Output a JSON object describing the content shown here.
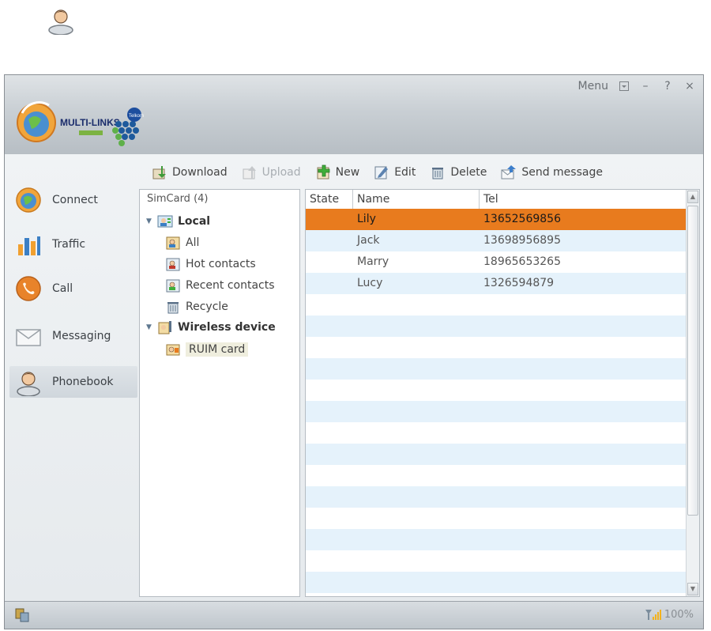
{
  "window": {
    "menu_label": "Menu",
    "controls": {
      "minimize": "–",
      "help": "?",
      "close": "×"
    }
  },
  "logo": {
    "brand": "MULTI-LINKS",
    "partner": "Telkom"
  },
  "sidebar": {
    "items": [
      {
        "label": "Connect",
        "icon": "globe-icon"
      },
      {
        "label": "Traffic",
        "icon": "bar-chart-icon"
      },
      {
        "label": "Call",
        "icon": "phone-icon"
      },
      {
        "label": "Messaging",
        "icon": "envelope-icon"
      },
      {
        "label": "Phonebook",
        "icon": "person-icon",
        "active": true
      }
    ]
  },
  "toolbar": {
    "download": "Download",
    "upload": "Upload",
    "new": "New",
    "edit": "Edit",
    "delete": "Delete",
    "send_message": "Send message"
  },
  "tree": {
    "header": "SimCard (4)",
    "local": "Local",
    "local_items": [
      "All",
      "Hot contacts",
      "Recent contacts",
      "Recycle"
    ],
    "wireless": "Wireless device",
    "wireless_items": [
      "RUIM card"
    ]
  },
  "table": {
    "columns": [
      "State",
      "Name",
      "Tel"
    ],
    "rows": [
      {
        "state": "",
        "name": "Lily",
        "tel": "13652569856",
        "selected": true
      },
      {
        "state": "",
        "name": "Jack",
        "tel": "13698956895"
      },
      {
        "state": "",
        "name": "Marry",
        "tel": "18965653265"
      },
      {
        "state": "",
        "name": "Lucy",
        "tel": "1326594879"
      }
    ],
    "empty_rows": 14
  },
  "status": {
    "signal": "100%"
  },
  "colors": {
    "selection": "#e87b1e",
    "row_alt": "#e5f2fb"
  }
}
